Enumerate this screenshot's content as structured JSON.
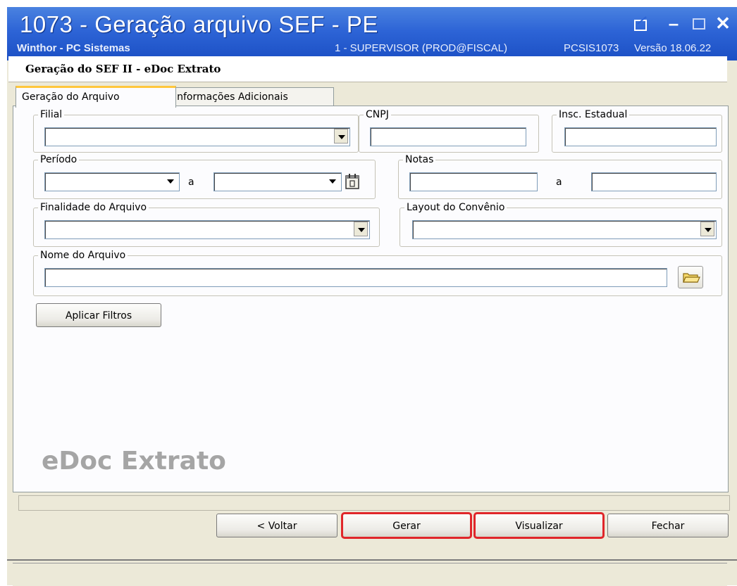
{
  "window": {
    "title": "1073 - Geração arquivo SEF - PE",
    "app_name": "Winthor - PC Sistemas",
    "user": "1 - SUPERVISOR (PROD@FISCAL)",
    "program": "PCSIS1073",
    "version": "Versão 18.06.22",
    "controls": [
      "restore-icon",
      "minimize-icon",
      "maximize-icon",
      "close-icon"
    ]
  },
  "header": {
    "title": "Geração do SEF II - eDoc Extrato"
  },
  "tabs": [
    {
      "label": "Geração do Arquivo",
      "active": true
    },
    {
      "label": "Informações Adicionais",
      "active": false
    }
  ],
  "form": {
    "filial": {
      "legend": "Filial",
      "value": ""
    },
    "cnpj": {
      "legend": "CNPJ",
      "value": ""
    },
    "insc_estadual": {
      "legend": "Insc. Estadual",
      "value": ""
    },
    "periodo": {
      "legend": "Período",
      "from": "",
      "separator": "a",
      "to": ""
    },
    "notas": {
      "legend": "Notas",
      "from": "",
      "separator": "a",
      "to": ""
    },
    "finalidade": {
      "legend": "Finalidade do Arquivo",
      "value": ""
    },
    "layout_convenio": {
      "legend": "Layout do Convênio",
      "value": ""
    },
    "nome_arquivo": {
      "legend": "Nome do Arquivo",
      "value": ""
    }
  },
  "buttons": {
    "aplicar_filtros": "Aplicar Filtros",
    "voltar": "< Voltar",
    "gerar": "Gerar",
    "visualizar": "Visualizar",
    "fechar": "Fechar"
  },
  "watermark": "eDoc Extrato",
  "highlight_color": "#e0262a"
}
